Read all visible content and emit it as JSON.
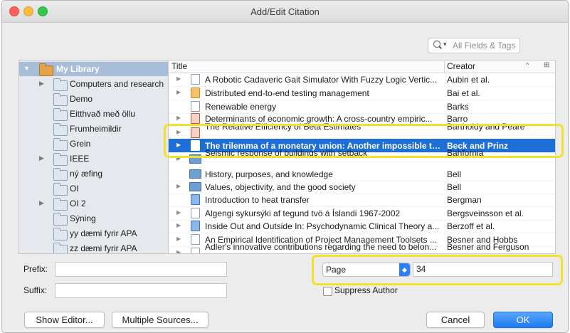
{
  "window": {
    "title": "Add/Edit Citation"
  },
  "search": {
    "placeholder": "All Fields & Tags"
  },
  "sidebar": {
    "items": [
      {
        "label": "My Library",
        "disclosure": "▼",
        "icon": "library-icon"
      },
      {
        "label": "Computers and research",
        "disclosure": "▶",
        "icon": "folder-icon"
      },
      {
        "label": "Demo",
        "disclosure": "",
        "icon": "folder-icon"
      },
      {
        "label": "Eitthvað með öllu",
        "disclosure": "",
        "icon": "folder-icon"
      },
      {
        "label": "Frumheimildir",
        "disclosure": "",
        "icon": "folder-icon"
      },
      {
        "label": "Grein",
        "disclosure": "",
        "icon": "folder-icon"
      },
      {
        "label": "IEEE",
        "disclosure": "▶",
        "icon": "folder-icon"
      },
      {
        "label": "ný æfing",
        "disclosure": "",
        "icon": "folder-icon"
      },
      {
        "label": "OI",
        "disclosure": "",
        "icon": "folder-icon"
      },
      {
        "label": "OI 2",
        "disclosure": "▶",
        "icon": "folder-icon"
      },
      {
        "label": "Sýning",
        "disclosure": "",
        "icon": "folder-icon"
      },
      {
        "label": "yy dæmi fyrir APA",
        "disclosure": "",
        "icon": "folder-icon"
      },
      {
        "label": "zz dæmi fyrir APA",
        "disclosure": "",
        "icon": "folder-icon"
      }
    ]
  },
  "list": {
    "headers": {
      "title": "Title",
      "creator": "Creator"
    },
    "sort_glyph": "^",
    "column_picker_glyph": "⊞",
    "rows": [
      {
        "disc": "▶",
        "type": "document",
        "title": "A Robotic Cadaveric Gait Simulator With Fuzzy Logic Vertic...",
        "creator": "Aubin et al."
      },
      {
        "disc": "▶",
        "type": "web",
        "title": "Distributed end-to-end testing management",
        "creator": "Bai et al."
      },
      {
        "disc": "",
        "type": "document",
        "title": "Renewable energy",
        "creator": "Barks"
      },
      {
        "disc": "▶",
        "type": "thesis",
        "title": "Determinants of economic growth: A cross-country empiric...",
        "creator": "Barro"
      },
      {
        "disc": "▶",
        "type": "thesis",
        "title": "The Relative Efficiency of Beta Estimates",
        "creator": "Bartholdy and Peare"
      },
      {
        "disc": "▶",
        "type": "document",
        "title": "The trilemma of a monetary union: Another impossible trinity",
        "creator": "Beck and Prinz",
        "selected": true
      },
      {
        "disc": "▶",
        "type": "book",
        "title": "Seismic response of buildings with setback",
        "creator": "Bahfornia"
      },
      {
        "disc": "",
        "type": "book",
        "title": "History, purposes, and knowledge",
        "creator": "Bell"
      },
      {
        "disc": "▶",
        "type": "book",
        "title": "Values, objectivity, and the good society",
        "creator": "Bell"
      },
      {
        "disc": "",
        "type": "journal",
        "title": "Introduction to heat transfer",
        "creator": "Bergman"
      },
      {
        "disc": "▶",
        "type": "document",
        "title": "Algengi sykursýki af tegund tvö á Íslandi 1967-2002",
        "creator": "Bergsveinsson et al."
      },
      {
        "disc": "▶",
        "type": "journal",
        "title": "Inside Out and Outside In: Psychodynamic Clinical Theory a...",
        "creator": "Berzoff et al."
      },
      {
        "disc": "▶",
        "type": "document",
        "title": "An Empirical Identification of Project Management Toolsets ...",
        "creator": "Besner and Hobbs"
      },
      {
        "disc": "▶",
        "type": "document",
        "title": "Adler's innovative contributions regarding the need to belon...",
        "creator": "Besner and Ferguson"
      }
    ]
  },
  "form": {
    "prefix_label": "Prefix:",
    "prefix_value": "",
    "suffix_label": "Suffix:",
    "suffix_value": "",
    "locator_type": "Page",
    "locator_value": "34",
    "suppress_author_label": "Suppress Author",
    "suppress_author_checked": false
  },
  "buttons": {
    "show_editor": "Show Editor...",
    "multiple_sources": "Multiple Sources...",
    "cancel": "Cancel",
    "ok": "OK"
  },
  "colors": {
    "selection": "#1e6ed8",
    "highlight_outline": "#f0e22c",
    "primary_button": "#1d7bf4"
  }
}
